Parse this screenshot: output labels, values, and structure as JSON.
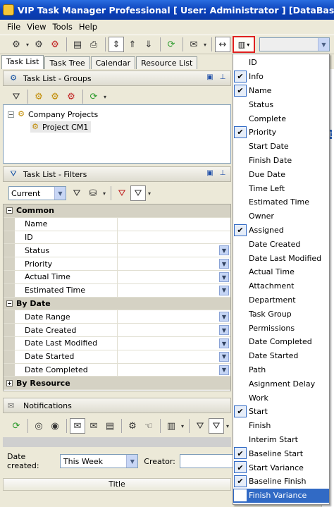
{
  "window": {
    "title": "VIP Task Manager Professional [ User: Administrator ] [DataBase: Company"
  },
  "menu": [
    "File",
    "View",
    "Tools",
    "Help"
  ],
  "tabs": [
    "Task List",
    "Task Tree",
    "Calendar",
    "Resource List"
  ],
  "groups_panel": {
    "title": "Task List - Groups",
    "tree": [
      {
        "label": "Company Projects",
        "expander": "−"
      },
      {
        "label": "Project CM1"
      }
    ]
  },
  "filters_panel": {
    "title": "Task List - Filters",
    "filter_value": "Current",
    "categories": [
      {
        "name": "Common",
        "toggle": "−",
        "rows": [
          "Name",
          "ID",
          "Status",
          "Priority",
          "Actual Time",
          "Estimated Time"
        ]
      },
      {
        "name": "By Date",
        "toggle": "−",
        "rows": [
          "Date Range",
          "Date Created",
          "Date Last Modified",
          "Date Started",
          "Date Completed"
        ]
      },
      {
        "name": "By Resource",
        "toggle": "+",
        "rows": []
      }
    ]
  },
  "notifications": {
    "title": "Notifications",
    "date_created_label": "Date created:",
    "date_created_value": "This Week",
    "creator_label": "Creator:",
    "column_title": "Title"
  },
  "right_strip_letters": [
    "e",
    "ct",
    "v",
    "a"
  ],
  "column_menu": [
    {
      "label": "ID",
      "checked": false
    },
    {
      "label": "Info",
      "checked": true
    },
    {
      "label": "Name",
      "checked": true
    },
    {
      "label": "Status",
      "checked": false
    },
    {
      "label": "Complete",
      "checked": false
    },
    {
      "label": "Priority",
      "checked": true
    },
    {
      "label": "Start Date",
      "checked": false
    },
    {
      "label": "Finish Date",
      "checked": false
    },
    {
      "label": "Due Date",
      "checked": false
    },
    {
      "label": "Time Left",
      "checked": false
    },
    {
      "label": "Estimated Time",
      "checked": false
    },
    {
      "label": "Owner",
      "checked": false
    },
    {
      "label": "Assigned",
      "checked": true
    },
    {
      "label": "Date Created",
      "checked": false
    },
    {
      "label": "Date Last Modified",
      "checked": false
    },
    {
      "label": "Actual Time",
      "checked": false
    },
    {
      "label": "Attachment",
      "checked": false
    },
    {
      "label": "Department",
      "checked": false
    },
    {
      "label": "Task Group",
      "checked": false
    },
    {
      "label": "Permissions",
      "checked": false
    },
    {
      "label": "Date Completed",
      "checked": false
    },
    {
      "label": "Date Started",
      "checked": false
    },
    {
      "label": "Path",
      "checked": false
    },
    {
      "label": "Asignment Delay",
      "checked": false
    },
    {
      "label": "Work",
      "checked": false
    },
    {
      "label": "Start",
      "checked": true
    },
    {
      "label": "Finish",
      "checked": false
    },
    {
      "label": "Interim Start",
      "checked": false
    },
    {
      "label": "Baseline Start",
      "checked": true
    },
    {
      "label": "Start Variance",
      "checked": true
    },
    {
      "label": "Baseline Finish",
      "checked": true
    },
    {
      "label": "Finish Variance",
      "checked": true,
      "highlighted": true
    }
  ]
}
